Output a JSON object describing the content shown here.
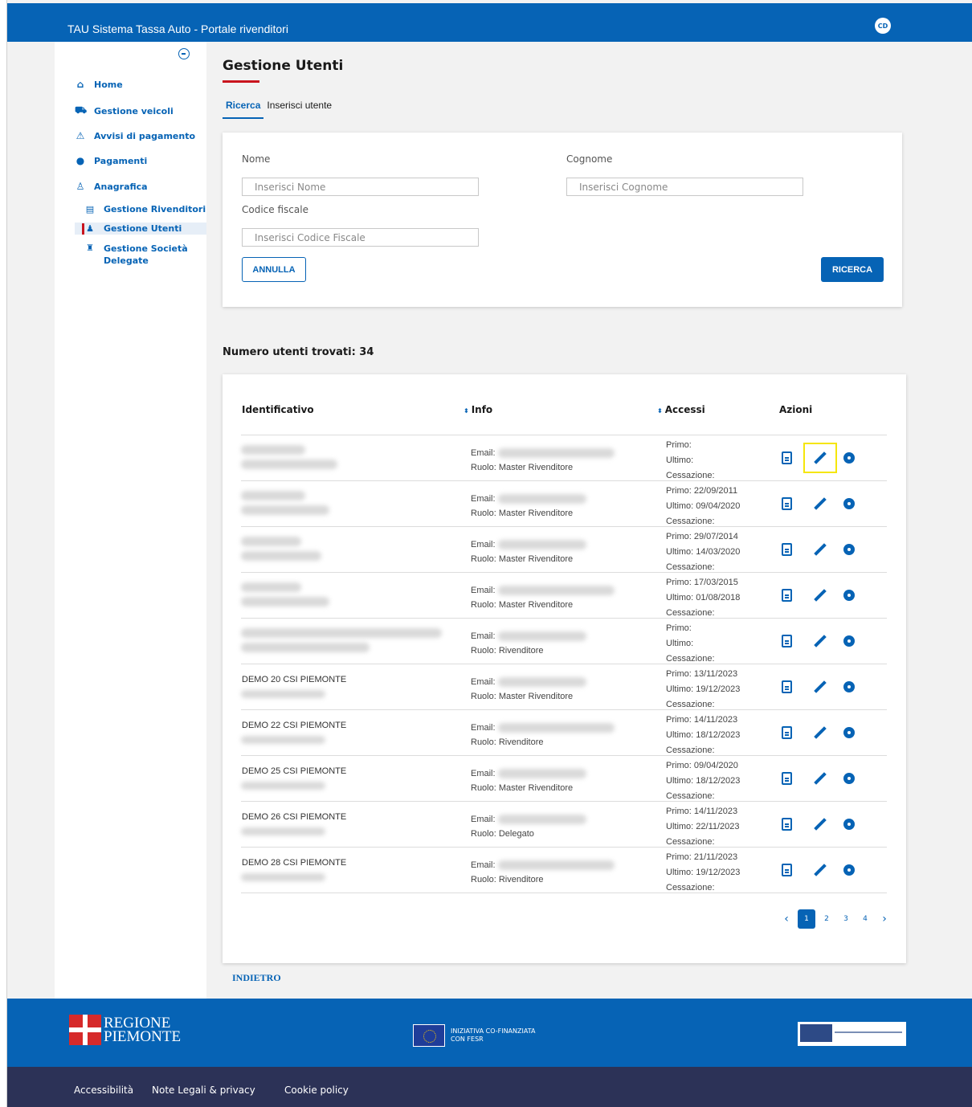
{
  "header": {
    "title": "TAU Sistema Tassa Auto - Portale rivenditori",
    "avatar_initials": "CD"
  },
  "sidebar": {
    "items": [
      {
        "label": "Home",
        "icon": "home-icon"
      },
      {
        "label": "Gestione veicoli",
        "icon": "car-icon"
      },
      {
        "label": "Avvisi di pagamento",
        "icon": "warning-icon"
      },
      {
        "label": "Pagamenti",
        "icon": "euro-icon"
      },
      {
        "label": "Anagrafica",
        "icon": "user-icon"
      }
    ],
    "subitems": [
      {
        "label": "Gestione Rivenditori",
        "icon": "store-icon"
      },
      {
        "label": "Gestione Utenti",
        "icon": "user-add-icon",
        "active": true
      },
      {
        "label": "Gestione Società Delegate",
        "icon": "group-icon"
      }
    ]
  },
  "page": {
    "title": "Gestione Utenti",
    "tabs": [
      "Ricerca",
      "Inserisci utente"
    ]
  },
  "search": {
    "nome_label": "Nome",
    "nome_placeholder": "Inserisci Nome",
    "cognome_label": "Cognome",
    "cognome_placeholder": "Inserisci Cognome",
    "cf_label": "Codice fiscale",
    "cf_placeholder": "Inserisci Codice Fiscale",
    "cancel_label": "ANNULLA",
    "search_label": "RICERCA"
  },
  "results": {
    "count_label": "Numero utenti trovati: 34",
    "columns": {
      "id": "Identificativo",
      "info": "Info",
      "access": "Accessi",
      "actions": "Azioni"
    },
    "rows": [
      {
        "ident": "",
        "email": "Email:",
        "role": "Ruolo: Master Rivenditore",
        "primo": "Primo:",
        "ultimo": "Ultimo:",
        "cess": "Cessazione:"
      },
      {
        "ident": "",
        "email": "Email:",
        "role": "Ruolo: Master Rivenditore",
        "primo": "Primo: 22/09/2011",
        "ultimo": "Ultimo: 09/04/2020",
        "cess": "Cessazione:"
      },
      {
        "ident": "",
        "email": "Email:",
        "role": "Ruolo: Master Rivenditore",
        "primo": "Primo: 29/07/2014",
        "ultimo": "Ultimo: 14/03/2020",
        "cess": "Cessazione:"
      },
      {
        "ident": "",
        "email": "Email:",
        "role": "Ruolo: Master Rivenditore",
        "primo": "Primo: 17/03/2015",
        "ultimo": "Ultimo: 01/08/2018",
        "cess": "Cessazione:"
      },
      {
        "ident": "",
        "email": "Email:",
        "role": "Ruolo: Rivenditore",
        "primo": "Primo:",
        "ultimo": "Ultimo:",
        "cess": "Cessazione:"
      },
      {
        "ident": "DEMO 20 CSI PIEMONTE",
        "email": "Email:",
        "role": "Ruolo: Master Rivenditore",
        "primo": "Primo: 13/11/2023",
        "ultimo": "Ultimo: 19/12/2023",
        "cess": "Cessazione:"
      },
      {
        "ident": "DEMO 22 CSI PIEMONTE",
        "email": "Email:",
        "role": "Ruolo: Rivenditore",
        "primo": "Primo: 14/11/2023",
        "ultimo": "Ultimo: 18/12/2023",
        "cess": "Cessazione:"
      },
      {
        "ident": "DEMO 25 CSI PIEMONTE",
        "email": "Email:",
        "role": "Ruolo: Master Rivenditore",
        "primo": "Primo: 09/04/2020",
        "ultimo": "Ultimo: 18/12/2023",
        "cess": "Cessazione:"
      },
      {
        "ident": "DEMO 26 CSI PIEMONTE",
        "email": "Email:",
        "role": "Ruolo: Delegato",
        "primo": "Primo: 14/11/2023",
        "ultimo": "Ultimo: 22/11/2023",
        "cess": "Cessazione:"
      },
      {
        "ident": "DEMO 28 CSI PIEMONTE",
        "email": "Email:",
        "role": "Ruolo: Rivenditore",
        "primo": "Primo: 21/11/2023",
        "ultimo": "Ultimo: 19/12/2023",
        "cess": "Cessazione:"
      }
    ],
    "pagination": {
      "pages": [
        "1",
        "2",
        "3",
        "4"
      ],
      "current": "1"
    }
  },
  "back_label": "INDIETRO",
  "footer": {
    "regione_line1": "REGIONE",
    "regione_line2": "PIEMONTE",
    "eu_line1": "INIZIATIVA CO-FINANZIATA",
    "eu_line2": "CON FESR",
    "links": [
      "Accessibilità",
      "Note Legali & privacy",
      "Cookie policy"
    ]
  },
  "colors": {
    "primary": "#0663b5",
    "accent_red": "#c9141e",
    "footer_dark": "#2c3257",
    "highlight": "#f5e60a"
  }
}
